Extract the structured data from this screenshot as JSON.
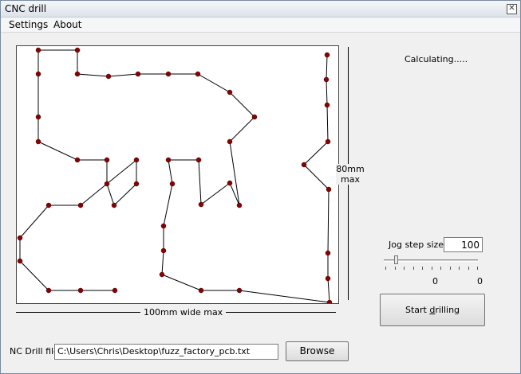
{
  "window": {
    "title": "CNC drill",
    "close_glyph": "✕"
  },
  "menu": {
    "items": [
      "Settings",
      "About"
    ]
  },
  "status": {
    "text": "Calculating....."
  },
  "dimensions": {
    "height_label_1": "80mm",
    "height_label_2": "max",
    "width_label": "100mm wide max"
  },
  "jog": {
    "label": "Jog step size",
    "value": "100",
    "slider_min_label": "0",
    "slider_max_label": "0",
    "slider_position": 0.1
  },
  "buttons": {
    "start_prefix": "Start ",
    "start_accel": "d",
    "start_suffix": "rilling",
    "browse": "Browse"
  },
  "file": {
    "label": "NC Drill file",
    "path": "C:\\Users\\Chris\\Desktop\\fuzz_factory_pcb.txt"
  },
  "colors": {
    "hole": "#8b0000",
    "path": "#000000"
  }
}
